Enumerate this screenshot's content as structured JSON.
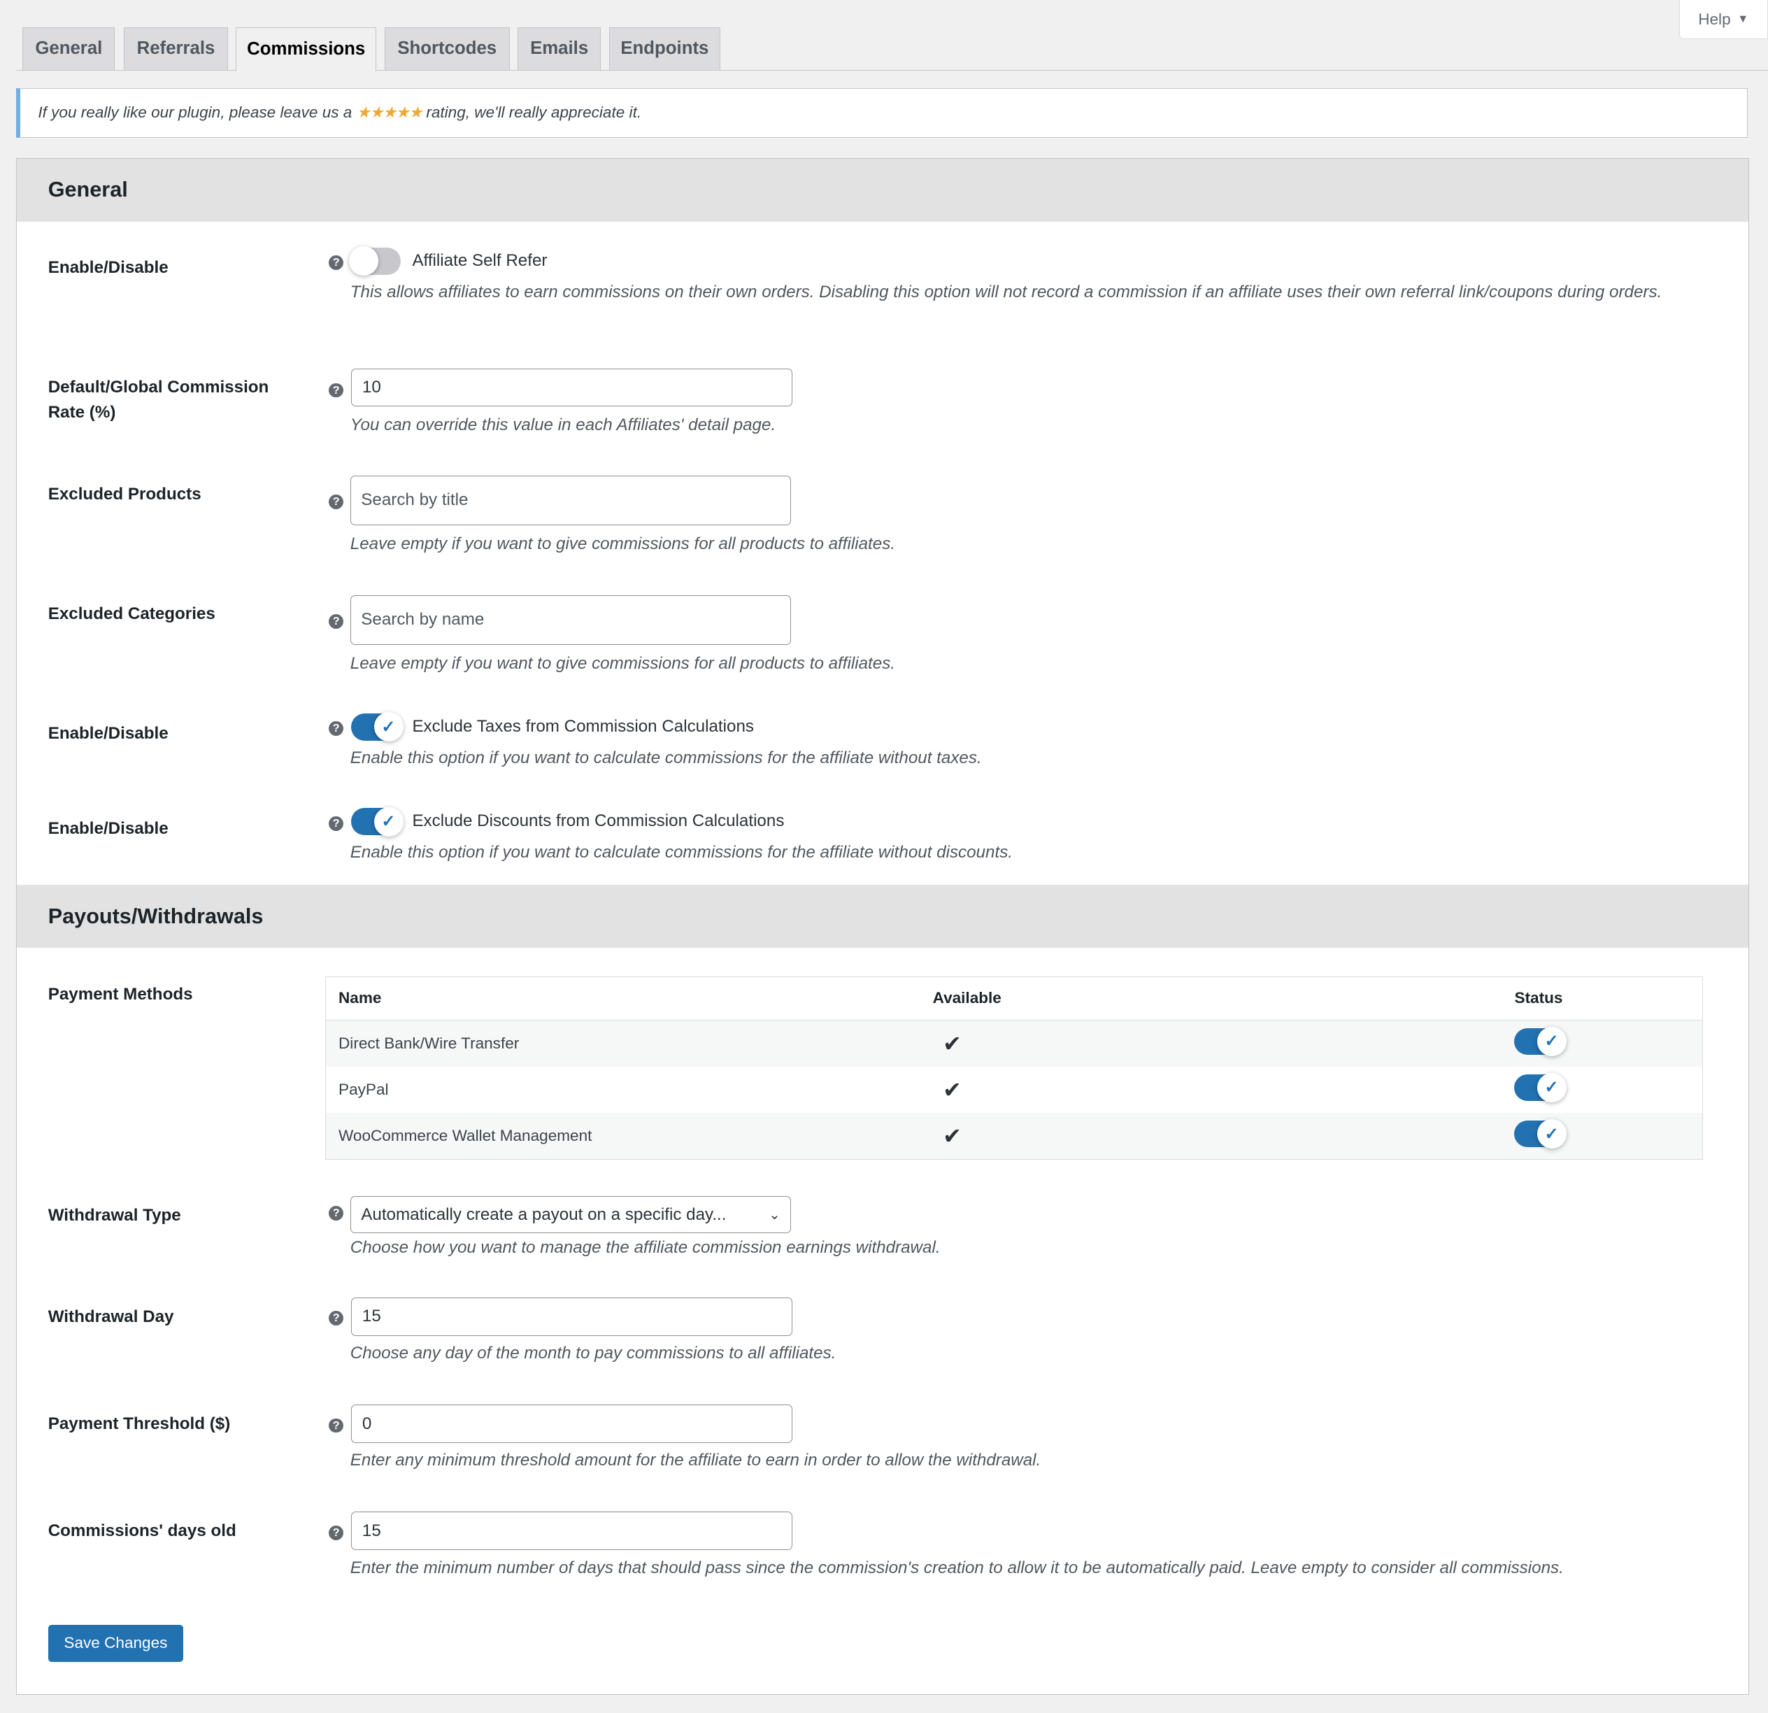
{
  "help_label": "Help",
  "tabs": [
    "General",
    "Referrals",
    "Commissions",
    "Shortcodes",
    "Emails",
    "Endpoints"
  ],
  "notice": {
    "before": "If you really like our plugin, please leave us a",
    "stars": "★★★★★",
    "after": "rating, we'll really appreciate it."
  },
  "general": {
    "title": "General",
    "self_refer": {
      "label": "Enable/Disable",
      "toggle_label": "Affiliate Self Refer",
      "enabled": false,
      "desc": "This allows affiliates to earn commissions on their own orders. Disabling this option will not record a commission if an affiliate uses their own referral link/coupons during orders."
    },
    "rate": {
      "label": "Default/Global Commission Rate (%)",
      "value": "10",
      "desc": "You can override this value in each Affiliates' detail page."
    },
    "excluded_products": {
      "label": "Excluded Products",
      "placeholder": "Search by title",
      "desc": "Leave empty if you want to give commissions for all products to affiliates."
    },
    "excluded_categories": {
      "label": "Excluded Categories",
      "placeholder": "Search by name",
      "desc": "Leave empty if you want to give commissions for all products to affiliates."
    },
    "taxes": {
      "label": "Enable/Disable",
      "toggle_label": "Exclude Taxes from Commission Calculations",
      "enabled": true,
      "desc": "Enable this option if you want to calculate commissions for the affiliate without taxes."
    },
    "discounts": {
      "label": "Enable/Disable",
      "toggle_label": "Exclude Discounts from Commission Calculations",
      "enabled": true,
      "desc": "Enable this option if you want to calculate commissions for the affiliate without discounts."
    }
  },
  "payouts": {
    "title": "Payouts/Withdrawals",
    "methods_label": "Payment Methods",
    "columns": [
      "Name",
      "Available",
      "Status"
    ],
    "methods": [
      {
        "name": "Direct Bank/Wire Transfer",
        "available": "✔",
        "enabled": true
      },
      {
        "name": "PayPal",
        "available": "✔",
        "enabled": true
      },
      {
        "name": "WooCommerce Wallet Management",
        "available": "✔",
        "enabled": true
      }
    ],
    "withdrawal_type": {
      "label": "Withdrawal Type",
      "value": "Automatically create a payout on a specific day...",
      "desc": "Choose how you want to manage the affiliate commission earnings withdrawal."
    },
    "withdrawal_day": {
      "label": "Withdrawal Day",
      "value": "15",
      "desc": "Choose any day of the month to pay commissions to all affiliates."
    },
    "threshold": {
      "label": "Payment Threshold ($)",
      "value": "0",
      "desc": "Enter any minimum threshold amount for the affiliate to earn in order to allow the withdrawal."
    },
    "days_old": {
      "label": "Commissions' days old",
      "value": "15",
      "desc": "Enter the minimum number of days that should pass since the commission's creation to allow it to be automatically paid. Leave empty to consider all commissions."
    }
  },
  "save_label": "Save Changes"
}
